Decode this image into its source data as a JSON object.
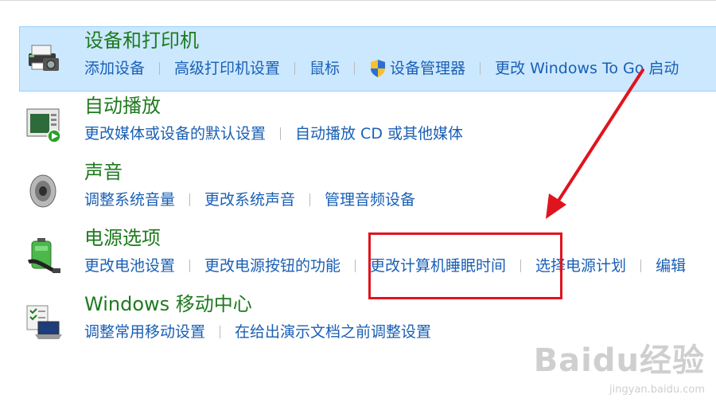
{
  "groups": [
    {
      "title": "设备和打印机",
      "icon": "printer-camera-icon",
      "links": [
        "添加设备",
        "高级打印机设置",
        "鼠标",
        "设备管理器",
        "更改 Windows To Go 启动"
      ]
    },
    {
      "title": "自动播放",
      "icon": "autoplay-icon",
      "links": [
        "更改媒体或设备的默认设置",
        "自动播放 CD 或其他媒体"
      ]
    },
    {
      "title": "声音",
      "icon": "speaker-icon",
      "links": [
        "调整系统音量",
        "更改系统声音",
        "管理音频设备"
      ]
    },
    {
      "title": "电源选项",
      "icon": "battery-plug-icon",
      "links": [
        "更改电池设置",
        "更改电源按钮的功能",
        "更改计算机睡眠时间",
        "选择电源计划",
        "编辑"
      ]
    },
    {
      "title": "Windows 移动中心",
      "icon": "mobility-center-icon",
      "links": [
        "调整常用移动设置",
        "在给出演示文档之前调整设置"
      ]
    }
  ],
  "watermark": {
    "logo": "Baidu经验",
    "url": "jingyan.baidu.com"
  },
  "colors": {
    "title": "#1e7a1e",
    "link": "#1a5fb4",
    "highlight": "#cce8ff",
    "annotation": "#e0141e"
  }
}
